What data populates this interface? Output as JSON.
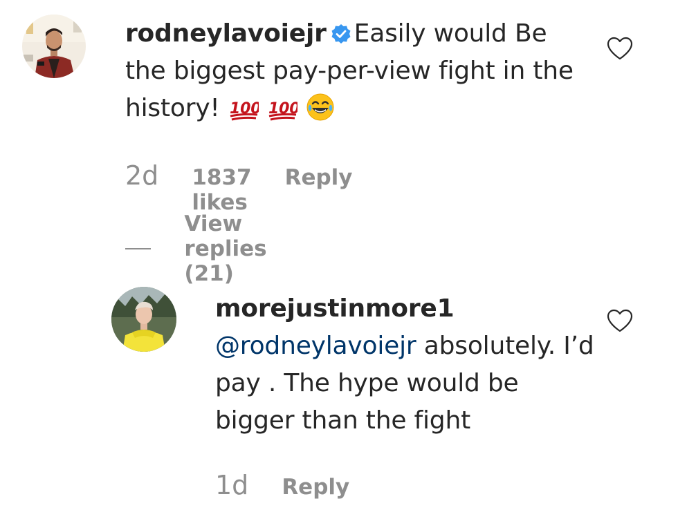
{
  "comments": [
    {
      "username": "rodneylavoiejr",
      "verified": true,
      "text": "Easily would Be the biggest pay-per-view fight in the history!",
      "emojis": [
        "hundred-points-emoji",
        "hundred-points-emoji",
        "tears-of-joy-emoji"
      ],
      "time": "2d",
      "likes": "1837 likes",
      "reply_label": "Reply",
      "view_replies": "View replies (21)"
    },
    {
      "username": "morejustinmore1",
      "mention": "@rodneylavoiejr",
      "text": "absolutely. I’d pay . The hype would be bigger than the fight",
      "time": "1d",
      "reply_label": "Reply"
    }
  ],
  "icons": {
    "like": "heart-outline-icon",
    "verified": "verified-badge-icon"
  },
  "colors": {
    "text": "#262626",
    "muted": "#8e8e8e",
    "mention": "#003569",
    "verified": "#3897f0"
  }
}
